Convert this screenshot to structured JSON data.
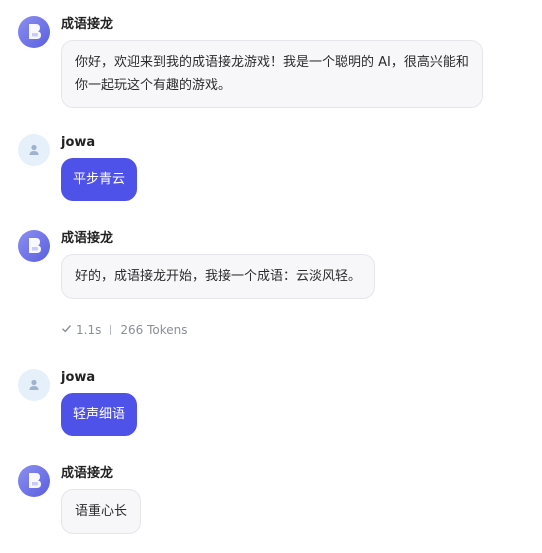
{
  "messages": [
    {
      "role": "bot",
      "name": "成语接龙",
      "line1": "你好，欢迎来到我的成语接龙游戏！我是一个聪明的 AI，很高兴能和",
      "line2": "你一起玩这个有趣的游戏。"
    },
    {
      "role": "user",
      "name": "jowa",
      "text": "平步青云"
    },
    {
      "role": "bot",
      "name": "成语接龙",
      "text": "好的，成语接龙开始，我接一个成语：云淡风轻。",
      "duration": "1.1s",
      "tokens": "266 Tokens"
    },
    {
      "role": "user",
      "name": "jowa",
      "text": "轻声细语"
    },
    {
      "role": "bot",
      "name": "成语接龙",
      "text": "语重心长"
    }
  ],
  "colors": {
    "accent": "#4f52e8",
    "bot_avatar": "#5a5fe0",
    "user_avatar": "#e6f0fb",
    "bot_bubble": "#f7f7f9"
  },
  "icons": {
    "bot_avatar": "brand-logo-icon",
    "user_avatar": "user-icon",
    "meta_check": "check-icon"
  }
}
